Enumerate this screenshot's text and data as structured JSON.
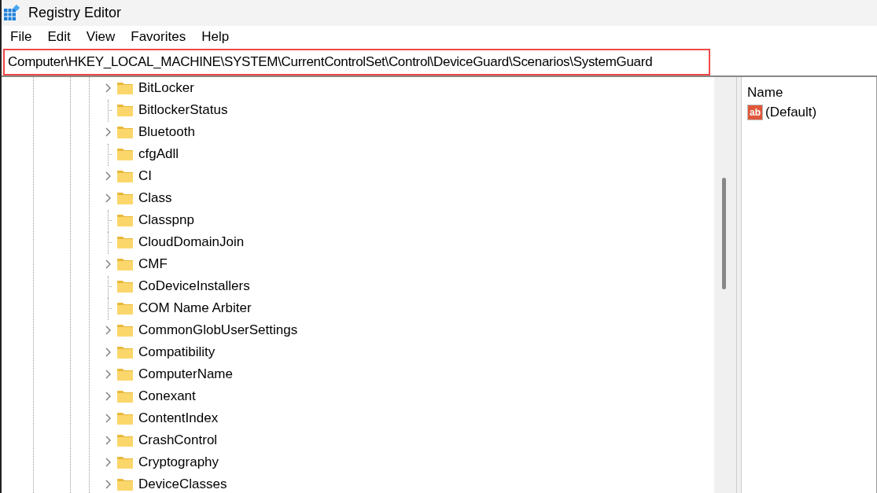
{
  "window": {
    "title": "Registry Editor"
  },
  "menu": [
    "File",
    "Edit",
    "View",
    "Favorites",
    "Help"
  ],
  "address_bar": {
    "value": "Computer\\HKEY_LOCAL_MACHINE\\SYSTEM\\CurrentControlSet\\Control\\DeviceGuard\\Scenarios\\SystemGuard",
    "highlighted": true
  },
  "tree": [
    {
      "label": "BitLocker",
      "kind": "branch"
    },
    {
      "label": "BitlockerStatus",
      "kind": "leaf"
    },
    {
      "label": "Bluetooth",
      "kind": "branch"
    },
    {
      "label": "cfgAdll",
      "kind": "leaf"
    },
    {
      "label": "CI",
      "kind": "branch"
    },
    {
      "label": "Class",
      "kind": "branch"
    },
    {
      "label": "Classpnp",
      "kind": "leaf"
    },
    {
      "label": "CloudDomainJoin",
      "kind": "leaf"
    },
    {
      "label": "CMF",
      "kind": "branch"
    },
    {
      "label": "CoDeviceInstallers",
      "kind": "leaf"
    },
    {
      "label": "COM Name Arbiter",
      "kind": "leaf"
    },
    {
      "label": "CommonGlobUserSettings",
      "kind": "branch"
    },
    {
      "label": "Compatibility",
      "kind": "branch"
    },
    {
      "label": "ComputerName",
      "kind": "branch"
    },
    {
      "label": "Conexant",
      "kind": "branch"
    },
    {
      "label": "ContentIndex",
      "kind": "branch"
    },
    {
      "label": "CrashControl",
      "kind": "branch"
    },
    {
      "label": "Cryptography",
      "kind": "branch"
    },
    {
      "label": "DeviceClasses",
      "kind": "branch"
    }
  ],
  "values_pane": {
    "columns": [
      "Name"
    ],
    "rows": [
      {
        "name": "(Default)",
        "icon_text": "ab"
      }
    ]
  }
}
